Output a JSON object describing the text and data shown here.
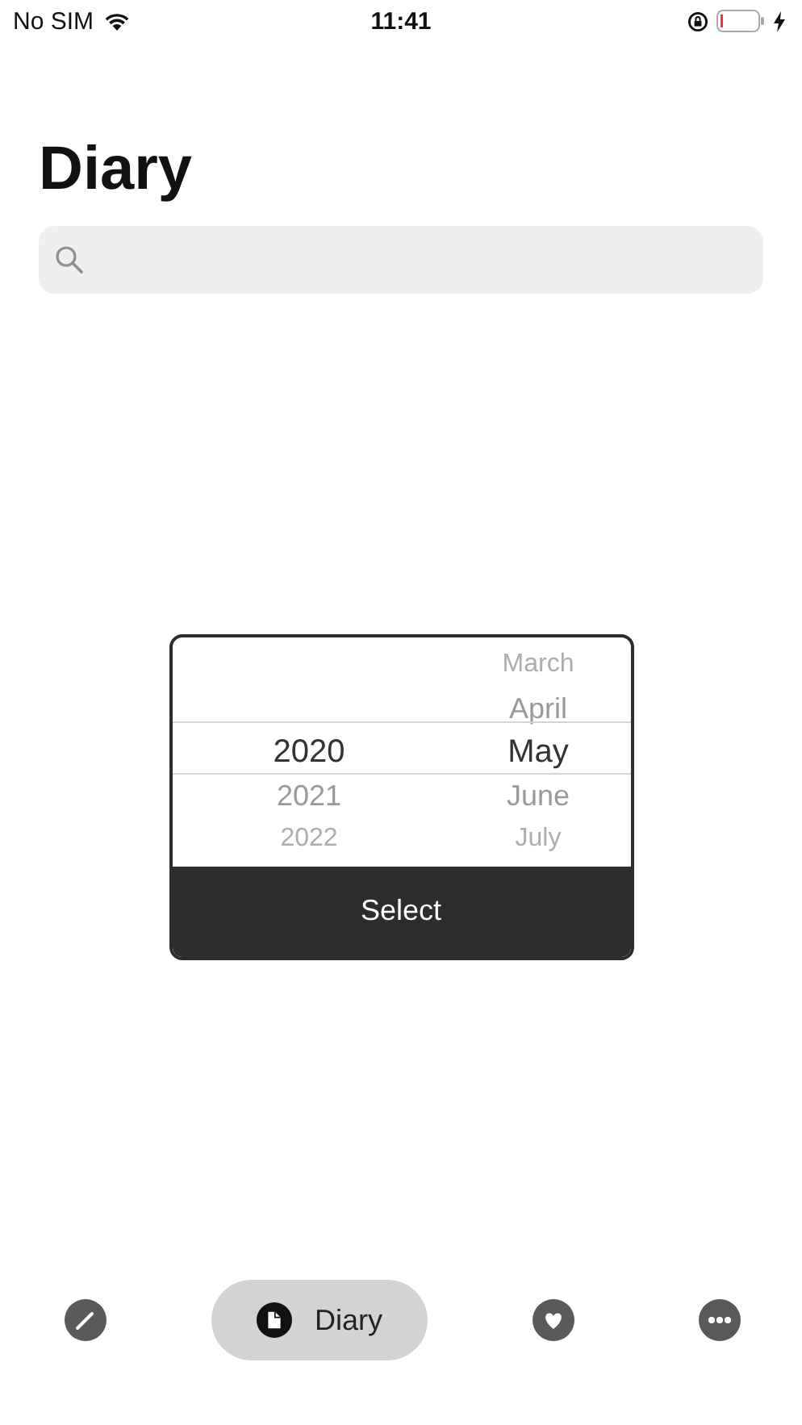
{
  "status_bar": {
    "carrier": "No SIM",
    "time": "11:41"
  },
  "title": "Diary",
  "picker": {
    "columns": [
      {
        "items": [
          {
            "label": "2020",
            "selected": true
          },
          {
            "label": "2021",
            "selected": false
          },
          {
            "label": "2022",
            "selected": false
          }
        ]
      },
      {
        "items": [
          {
            "label": "March",
            "selected": false
          },
          {
            "label": "April",
            "selected": false
          },
          {
            "label": "May",
            "selected": true
          },
          {
            "label": "June",
            "selected": false
          },
          {
            "label": "July",
            "selected": false
          }
        ]
      }
    ],
    "button": "Select"
  },
  "tabs": [
    {
      "kind": "write",
      "selected": false
    },
    {
      "kind": "diary",
      "label": "Diary",
      "selected": true
    },
    {
      "kind": "favorites",
      "selected": false
    },
    {
      "kind": "more",
      "selected": false
    }
  ]
}
